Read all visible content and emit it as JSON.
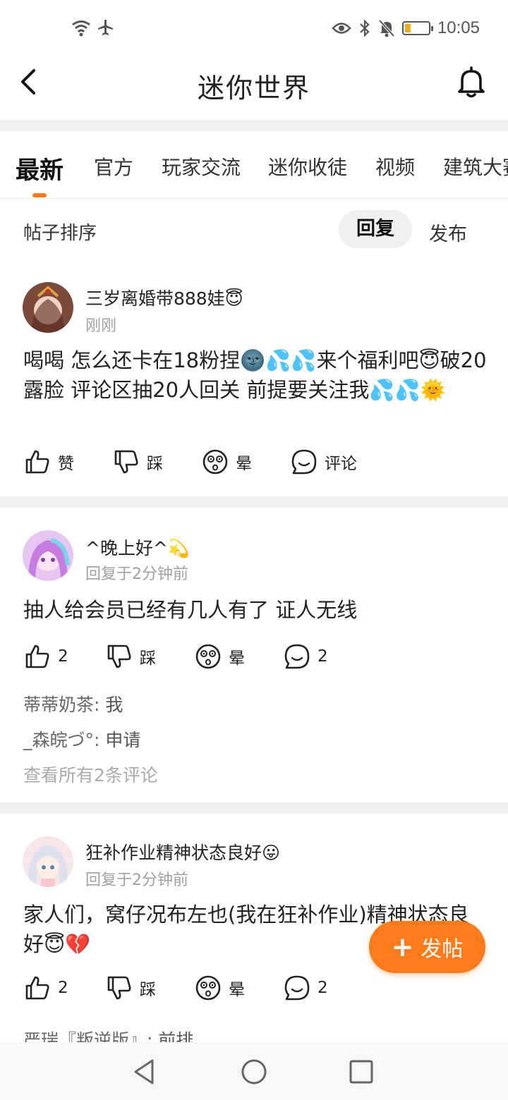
{
  "status_bar": {
    "time": "10:05",
    "battery_color": "#f5a623"
  },
  "header": {
    "title": "迷你世界"
  },
  "tabs": [
    {
      "label": "最新",
      "active": true
    },
    {
      "label": "官方"
    },
    {
      "label": "玩家交流"
    },
    {
      "label": "迷你收徒"
    },
    {
      "label": "视频"
    },
    {
      "label": "建筑大赛"
    }
  ],
  "sort": {
    "label": "帖子排序",
    "options": [
      "回复",
      "发布"
    ],
    "selected": "回复"
  },
  "posts": [
    {
      "username": "三岁离婚带888娃😇",
      "time": "刚刚",
      "text": "喝喝 怎么还卡在18粉捏🌚💦💦来个福利吧😇破20露脸 评论区抽20人回关 前提要关注我💦💦🌞",
      "actions": {
        "like": "赞",
        "dislike": "踩",
        "dizzy": "晕",
        "comment": "评论"
      },
      "comments": []
    },
    {
      "username": "^晚上好^💫",
      "time": "回复于2分钟前",
      "text": "抽人给会员已经有几人有了 证人无线",
      "actions": {
        "like": "2",
        "dislike": "踩",
        "dizzy": "晕",
        "comment": "2"
      },
      "comments": [
        {
          "user": "蒂蒂奶茶:",
          "text": "我"
        },
        {
          "user": "_森皖づ°:",
          "text": "申请"
        }
      ],
      "view_all": "查看所有2条评论"
    },
    {
      "username": "狂补作业精神状态良好😛",
      "time": "回复于2分钟前",
      "text": "家人们，窝仔况布左也(我在狂补作业)精神状态良好😇💔",
      "actions": {
        "like": "2",
        "dislike": "踩",
        "dizzy": "晕",
        "comment": "2"
      },
      "comments": [
        {
          "user": "严瑞『叛逆版』:",
          "text": "前排"
        }
      ]
    }
  ],
  "fab": {
    "label": "发帖"
  },
  "accent_color": "#ff7a1a"
}
